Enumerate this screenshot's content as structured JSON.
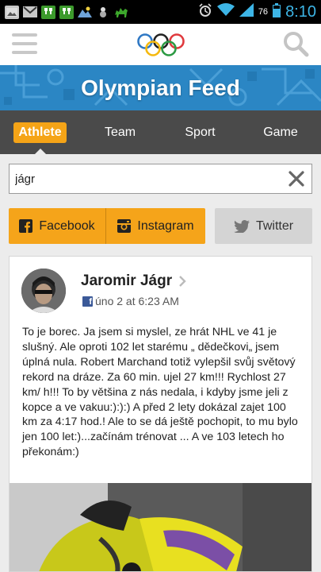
{
  "statusbar": {
    "battery_percent": "76",
    "time": "8:10",
    "notification_icons": [
      "image-icon",
      "gmail-icon",
      "hangouts-icon",
      "hangouts-icon",
      "weather-icon",
      "bug-icon",
      "camel-icon"
    ],
    "system_icons": [
      "alarm-icon",
      "wifi-icon",
      "signal-icon",
      "battery-icon"
    ]
  },
  "header": {
    "menu_icon": "hamburger-icon",
    "logo": "olympic-rings-logo",
    "search_icon": "search-icon"
  },
  "banner": {
    "title": "Olympian Feed"
  },
  "tabs": [
    {
      "label": "Athlete",
      "active": true
    },
    {
      "label": "Team",
      "active": false
    },
    {
      "label": "Sport",
      "active": false
    },
    {
      "label": "Game",
      "active": false
    }
  ],
  "search": {
    "value": "jágr"
  },
  "filters": {
    "facebook": "Facebook",
    "instagram": "Instagram",
    "twitter": "Twitter"
  },
  "post": {
    "author": "Jaromir Jágr",
    "date": "úno 2 at 6:23 AM",
    "source_icon": "facebook-icon",
    "text": "To je borec. Ja jsem si myslel, ze hrát NHL ve 41 je slušný. Ale oproti 102 let starému „ dědečkovi„ jsem úplná nula. Robert Marchand totiž vylepšil svůj světový rekord na dráze. Za 60 min. ujel 27 km!!! Rychlost 27 km/ h!!! To by většina z nás nedala, i kdyby jsme jeli z kopce a ve vakuu:):):) A před 2 lety dokázal zajet 100 km za 4:17 hod.! Ale to se dá ještě pochopit, to mu bylo jen 100 let:)...začínám trénovat ... A ve 103 letech ho překonám:)"
  },
  "colors": {
    "accent": "#f5a417",
    "banner": "#2d86c2",
    "tabbar": "#4a4a4a",
    "status_time": "#3db5e6",
    "facebook": "#3b5998"
  }
}
